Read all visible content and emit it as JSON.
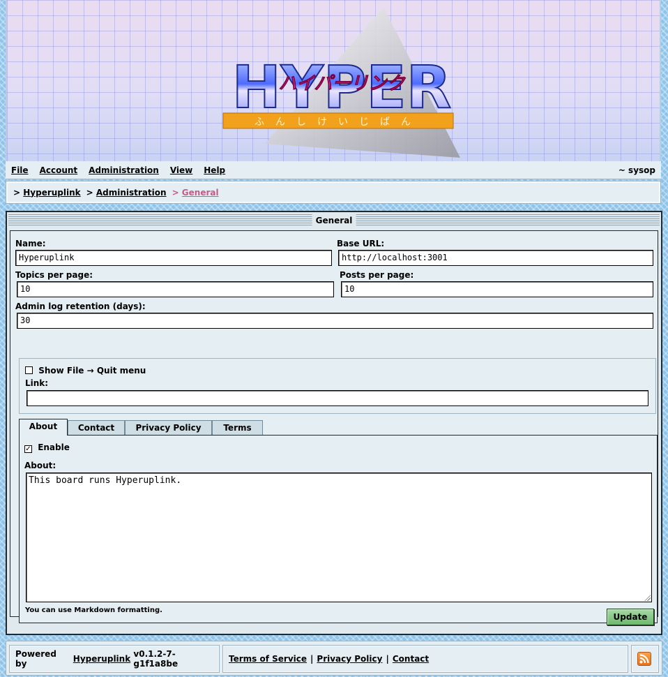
{
  "banner": {
    "logo_text": "HYPER",
    "logo_subtitle": "ハイパーリンク",
    "logo_kana": "ふんしけいじばん"
  },
  "menubar": {
    "items": [
      {
        "label": "File"
      },
      {
        "label": "Account"
      },
      {
        "label": "Administration"
      },
      {
        "label": "View"
      },
      {
        "label": "Help"
      }
    ],
    "user": "~ sysop"
  },
  "breadcrumb": {
    "items": [
      "Hyperuplink",
      "Administration"
    ],
    "current": "General"
  },
  "panel": {
    "title": "General",
    "fields": {
      "name": {
        "label": "Name:",
        "value": "Hyperuplink"
      },
      "base_url": {
        "label": "Base URL:",
        "value": "http://localhost:3001"
      },
      "topics_per_page": {
        "label": "Topics per page:",
        "value": "10"
      },
      "posts_per_page": {
        "label": "Posts per page:",
        "value": "10"
      },
      "admin_log_retention": {
        "label": "Admin log retention (days):",
        "value": "30"
      }
    },
    "quit_menu": {
      "checkbox_label": "Show File → Quit menu",
      "checked": false,
      "link_label": "Link:",
      "link_value": ""
    },
    "tabs": [
      {
        "label": "About"
      },
      {
        "label": "Contact"
      },
      {
        "label": "Privacy Policy"
      },
      {
        "label": "Terms"
      }
    ],
    "about": {
      "enable_label": "Enable",
      "enabled": true,
      "textarea_label": "About:",
      "textarea_value": "This board runs Hyperuplink.",
      "hint": "You can use Markdown formatting."
    },
    "update_label": "Update"
  },
  "footer": {
    "powered_prefix": "Powered by",
    "powered_link": "Hyperuplink",
    "version": "v0.1.2-7-g1f1a8be",
    "links": [
      "Terms of Service",
      "Privacy Policy",
      "Contact"
    ],
    "separator": "|"
  },
  "colors": {
    "breadcrumb_current": "#c45c88",
    "update_button": "#8ccc8c",
    "rss": "#f08a30"
  }
}
